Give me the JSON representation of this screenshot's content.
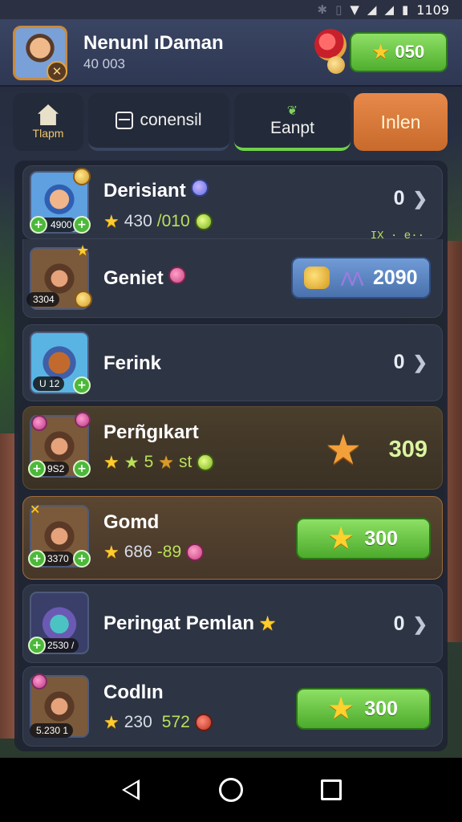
{
  "status_bar": {
    "time": "1109",
    "icons": [
      "bluetooth-icon",
      "vibrate-icon",
      "wifi-icon",
      "signal-icon",
      "signal-icon",
      "battery-icon"
    ]
  },
  "header": {
    "player_name": "Nenunl ıDaman",
    "player_sub": "40 003",
    "coins": "050"
  },
  "tabs": [
    {
      "label": "Tlapm",
      "icon": "house-icon"
    },
    {
      "label": "conensil",
      "icon": "chest-icon"
    },
    {
      "label": "Eanpt",
      "icon": "leaf-icon"
    },
    {
      "label": "Inlen"
    }
  ],
  "rows": [
    {
      "title": "Derisiant",
      "tag": "4900",
      "stat_a": "430",
      "stat_b": "/010",
      "value": "0"
    },
    {
      "title": "Geniet",
      "tag": "3304",
      "deco": "IX  ·  e··",
      "button": "2090"
    },
    {
      "title": "Ferink",
      "tag": "U 12",
      "value": "0"
    },
    {
      "title": "Perñgıkart",
      "tag": "9S2",
      "stat_a": "5",
      "stat_b": "st",
      "value": "309"
    },
    {
      "title": "Gomd",
      "tag": "3370",
      "stat_a": "686",
      "stat_b": "-89",
      "button": "300"
    },
    {
      "title": "Peringat Pemlan",
      "tag": "2530 /",
      "value": "0"
    },
    {
      "title": "Codlın",
      "tag": "5.230 1",
      "stat_a": "230",
      "stat_b": "572",
      "button": "300"
    }
  ],
  "colors": {
    "accent_green": "#5ab83a",
    "accent_orange": "#d97a3a",
    "panel": "#2d3444"
  }
}
